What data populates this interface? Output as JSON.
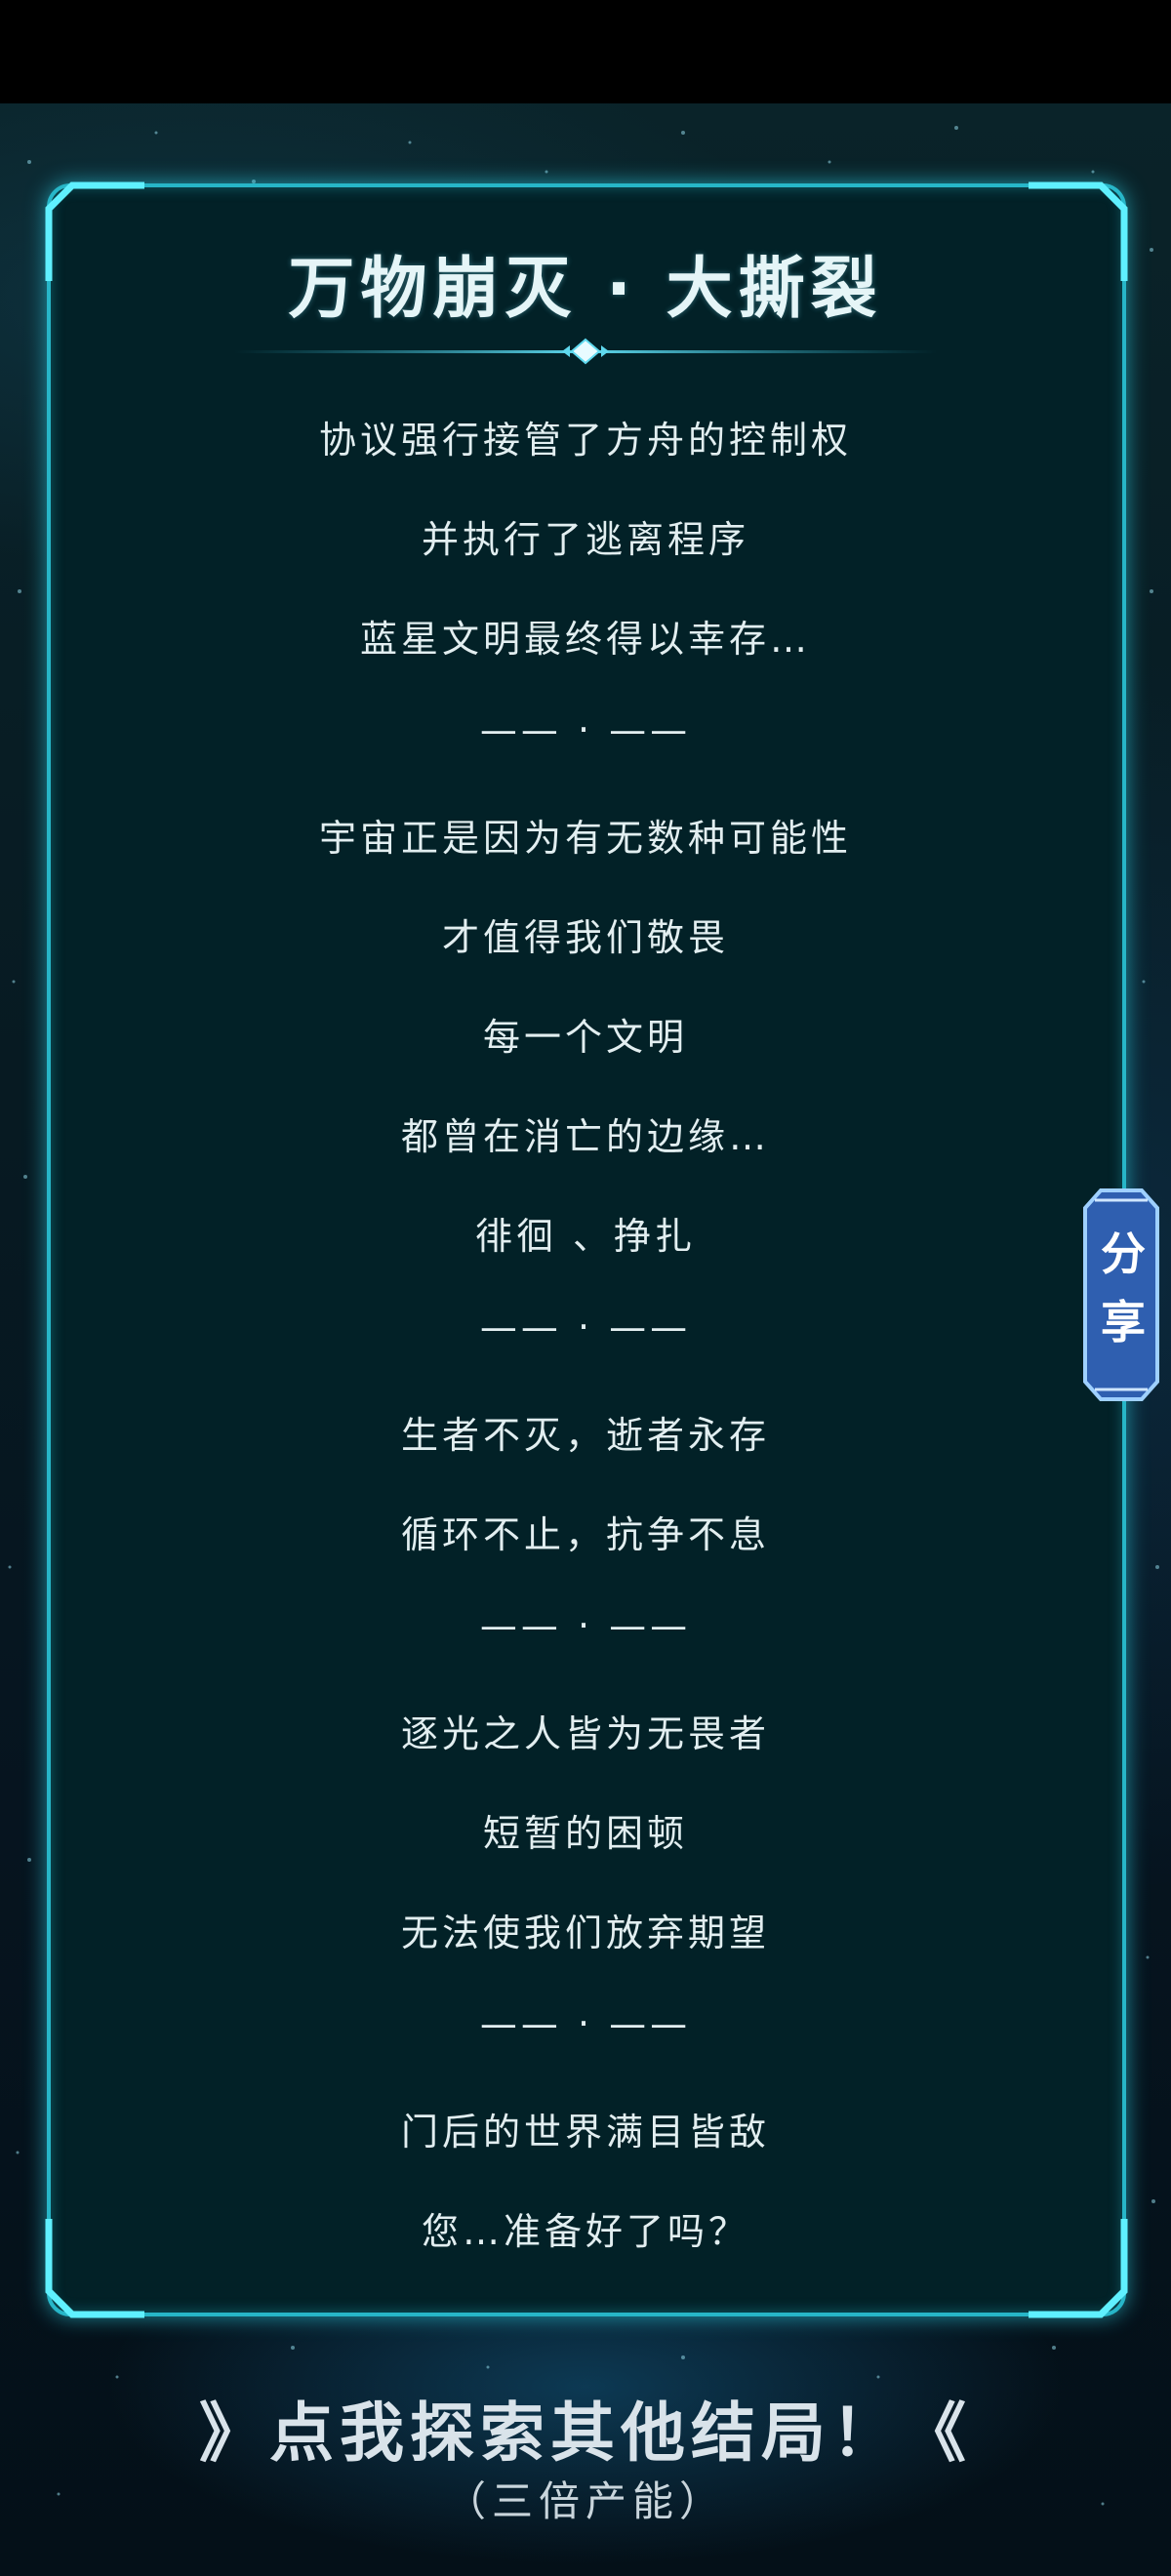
{
  "title": "万物崩灭 · 大撕裂",
  "lines": [
    "协议强行接管了方舟的控制权",
    "并执行了逃离程序",
    "蓝星文明最终得以幸存…",
    "—— · ——",
    "宇宙正是因为有无数种可能性",
    "才值得我们敬畏",
    "每一个文明",
    "都曾在消亡的边缘…",
    "徘徊 、挣扎",
    "—— · ——",
    "生者不灭，逝者永存",
    "循环不止，抗争不息",
    "—— · ——",
    "逐光之人皆为无畏者",
    "短暂的困顿",
    "无法使我们放弃期望",
    "—— · ——",
    "门后的世界满目皆敌",
    "您…准备好了吗？"
  ],
  "share": {
    "label": "分享"
  },
  "explore": {
    "label": "》点我探索其他结局！《",
    "sub_label": "（三倍产能）"
  },
  "colors": {
    "panel_border": "#27b6c8",
    "panel_fill": "#022127",
    "share_tab": "#2f5fb0",
    "text": "#e2eef0"
  }
}
